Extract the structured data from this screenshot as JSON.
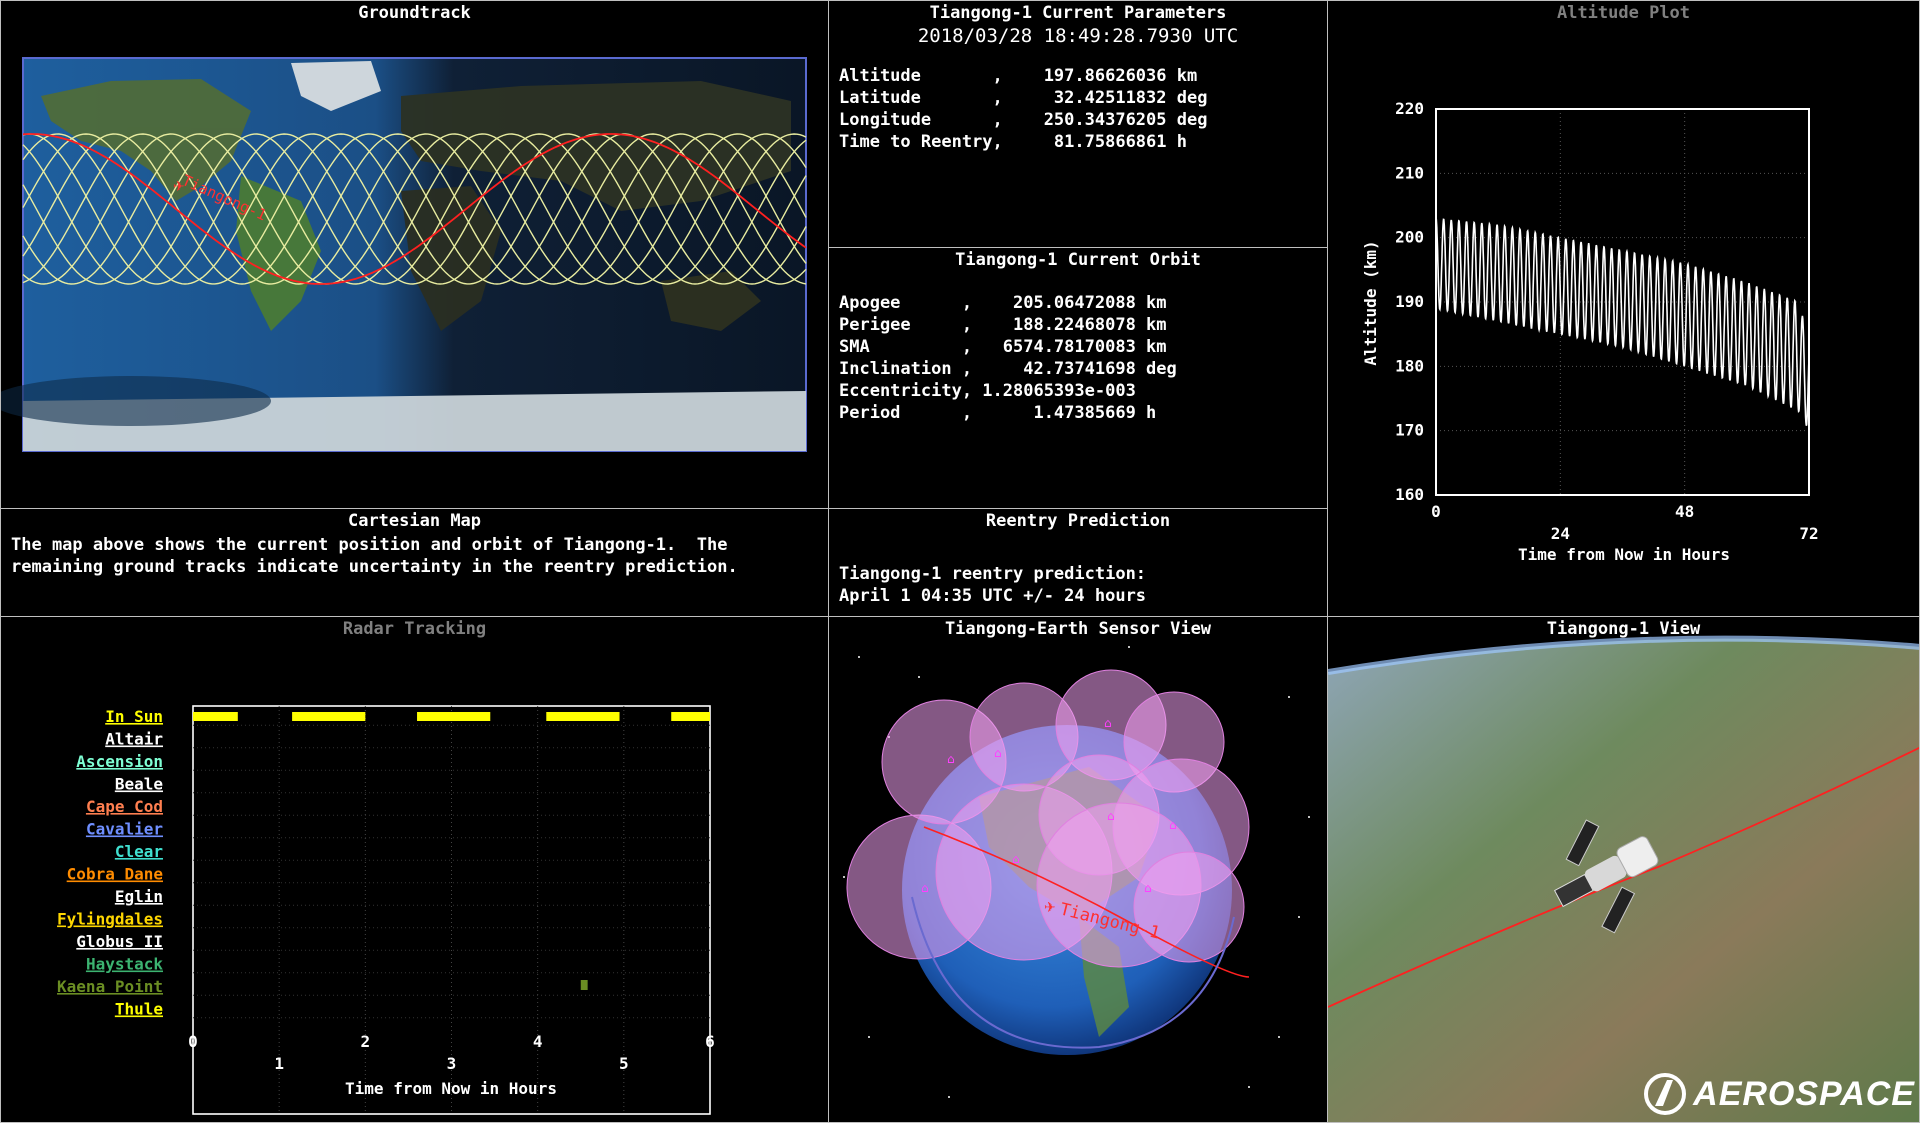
{
  "groundtrack": {
    "title": "Groundtrack",
    "sat_label": "Tiangong-1"
  },
  "params": {
    "title": "Tiangong-1 Current Parameters",
    "timestamp": "2018/03/28 18:49:28.7930 UTC",
    "rows": [
      "Altitude       ,    197.86626036 km",
      "Latitude       ,     32.42511832 deg",
      "Longitude      ,    250.34376205 deg",
      "Time to Reentry,     81.75866861 h"
    ]
  },
  "orbit": {
    "title": "Tiangong-1 Current Orbit",
    "rows": [
      "Apogee      ,    205.06472088 km",
      "Perigee     ,    188.22468078 km",
      "SMA         ,   6574.78170083 km",
      "Inclination ,     42.73741698 deg",
      "Eccentricity, 1.28065393e-003",
      "Period      ,      1.47385669 h"
    ]
  },
  "cartesian": {
    "title": "Cartesian Map",
    "text_line1": "The map above shows the current position and orbit of Tiangong-1.  The",
    "text_line2": "remaining ground tracks indicate uncertainty in the reentry prediction."
  },
  "reentry": {
    "title": "Reentry Prediction",
    "line1": "Tiangong-1 reentry prediction:",
    "line2": "April 1 04:35 UTC +/- 24 hours"
  },
  "radar": {
    "title": "Radar Tracking",
    "xlabel": "Time from Now in Hours",
    "x_ticks_top": [
      "0",
      "2",
      "4",
      "6"
    ],
    "x_ticks_bottom": [
      "1",
      "3",
      "5"
    ],
    "rows": [
      {
        "label": "In Sun",
        "color": "#ffff00"
      },
      {
        "label": "Altair",
        "color": "#ffffff"
      },
      {
        "label": "Ascension",
        "color": "#7fffd4"
      },
      {
        "label": "Beale",
        "color": "#ffffff"
      },
      {
        "label": "Cape Cod",
        "color": "#ff7f50"
      },
      {
        "label": "Cavalier",
        "color": "#6f8fff"
      },
      {
        "label": "Clear",
        "color": "#40e0d0"
      },
      {
        "label": "Cobra Dane",
        "color": "#ff8c00"
      },
      {
        "label": "Eglin",
        "color": "#ffffff"
      },
      {
        "label": "Fylingdales",
        "color": "#ffd700"
      },
      {
        "label": "Globus II",
        "color": "#ffffff"
      },
      {
        "label": "Haystack",
        "color": "#3cb371"
      },
      {
        "label": "Kaena Point",
        "color": "#6b8e23"
      },
      {
        "label": "Thule",
        "color": "#ffff00"
      }
    ],
    "in_sun_intervals": [
      [
        0,
        0.52
      ],
      [
        1.15,
        2.0
      ],
      [
        2.6,
        3.45
      ],
      [
        4.1,
        4.95
      ],
      [
        5.55,
        6.0
      ]
    ],
    "kaena_point_intervals": [
      [
        4.5,
        4.58
      ]
    ]
  },
  "altitude": {
    "title": "Altitude Plot",
    "ylabel": "Altitude (km)",
    "xlabel": "Time from Now in Hours",
    "y_ticks": [
      "220",
      "210",
      "200",
      "190",
      "180",
      "170",
      "160"
    ],
    "x_ticks_top": [
      "0",
      "48"
    ],
    "x_ticks_bottom": [
      "24",
      "72"
    ]
  },
  "chart_data": {
    "type": "line",
    "title": "Altitude Plot",
    "xlabel": "Time from Now in Hours",
    "ylabel": "Altitude (km)",
    "xlim": [
      0,
      72
    ],
    "ylim": [
      160,
      220
    ],
    "orbit_period_h": 1.47385669,
    "series": [
      {
        "x": [
          0,
          12,
          24,
          36,
          48,
          60,
          70,
          72
        ],
        "max": [
          203,
          202,
          200,
          198,
          196,
          193,
          190,
          184
        ],
        "min": [
          189,
          187,
          185,
          183,
          180,
          177,
          173,
          170
        ]
      }
    ]
  },
  "sensor": {
    "title": "Tiangong-Earth Sensor View",
    "sat_label": "Tiangong-1"
  },
  "satview": {
    "title": "Tiangong-1 View",
    "logo": "AEROSPACE"
  }
}
